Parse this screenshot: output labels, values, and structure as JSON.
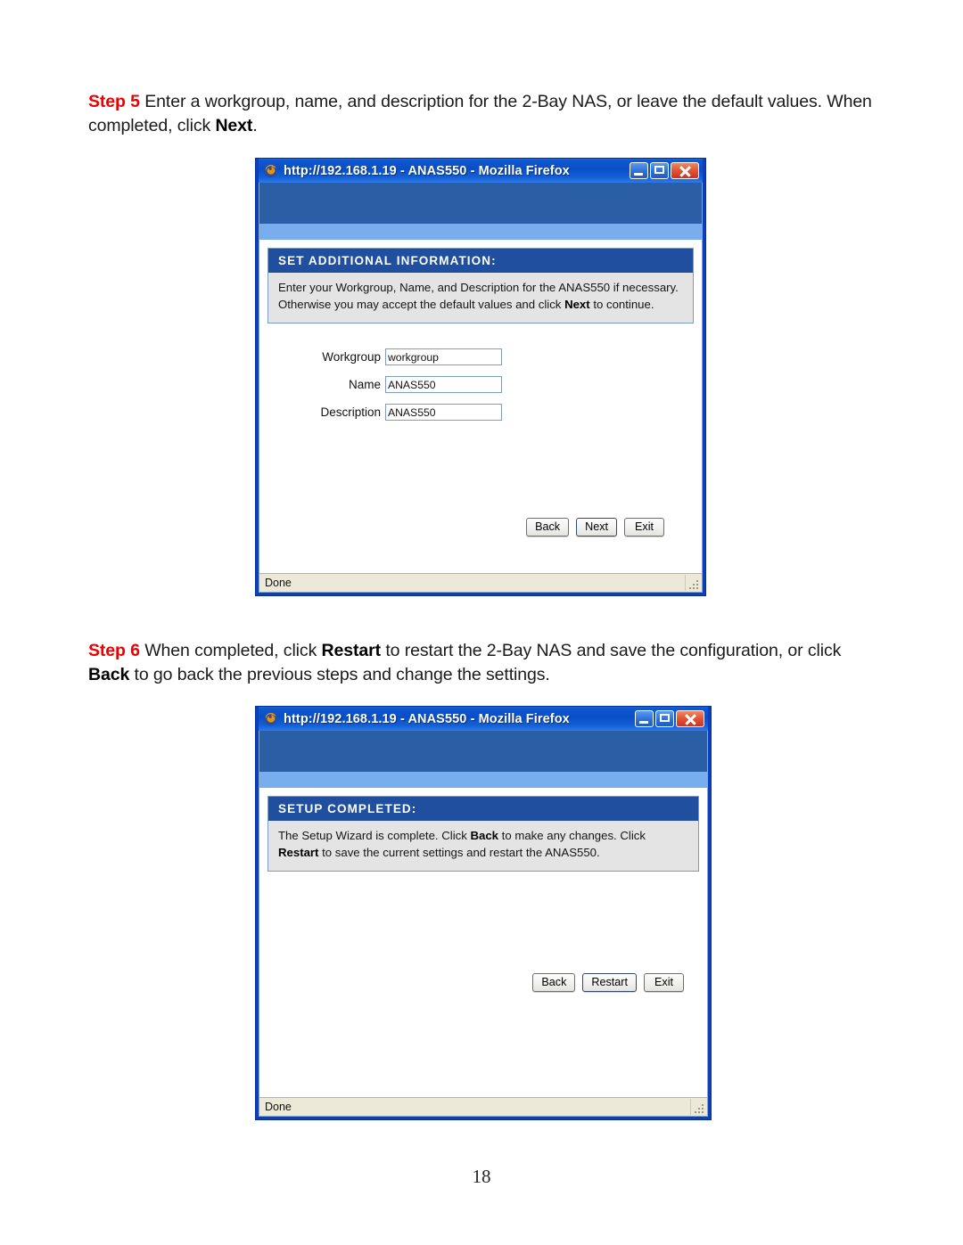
{
  "document": {
    "page_number": "18"
  },
  "steps": [
    {
      "label": "Step 5",
      "text_before_bold": " Enter a workgroup, name, and description for the 2-Bay NAS, or leave the default values. When completed, click ",
      "bold_word": "Next",
      "text_after_bold": "."
    },
    {
      "label": "Step 6",
      "text_1": " When completed, click ",
      "bold_1": "Restart",
      "text_2": " to restart the 2-Bay NAS and save the configuration, or click ",
      "bold_2": "Back",
      "text_3": " to go back the previous steps and change the settings."
    }
  ],
  "window_step5": {
    "title": "http://192.168.1.19 - ANAS550 - Mozilla Firefox",
    "panel": {
      "heading": "SET ADDITIONAL INFORMATION:",
      "body_1": "Enter your Workgroup, Name, and Description for the ANAS550 if necessary. Otherwise you may accept the default values and click ",
      "body_bold": "Next",
      "body_2": " to continue."
    },
    "form": {
      "fields": [
        {
          "label": "Workgroup",
          "value": "workgroup"
        },
        {
          "label": "Name",
          "value": "ANAS550"
        },
        {
          "label": "Description",
          "value": "ANAS550"
        }
      ]
    },
    "buttons": [
      {
        "label": "Back"
      },
      {
        "label": "Next"
      },
      {
        "label": "Exit"
      }
    ],
    "status": "Done"
  },
  "window_step6": {
    "title": "http://192.168.1.19 - ANAS550 - Mozilla Firefox",
    "panel": {
      "heading": "SETUP COMPLETED:",
      "body_1": "The Setup Wizard is complete.  Click ",
      "body_bold_1": "Back",
      "body_2": " to make any changes.  Click ",
      "body_bold_2": "Restart",
      "body_3": " to save the current settings and restart the ANAS550."
    },
    "buttons": [
      {
        "label": "Back"
      },
      {
        "label": "Restart"
      },
      {
        "label": "Exit"
      }
    ],
    "status": "Done"
  },
  "colors": {
    "step_label": "#ee0000",
    "titlebar_blue": "#0a4ec6",
    "panel_head_blue": "#1f4f9e",
    "brand_band": "#2a5ea5",
    "brand_band_light": "#79aeee",
    "window_border": "#0b3fbb",
    "statusbar": "#ece9d8"
  }
}
